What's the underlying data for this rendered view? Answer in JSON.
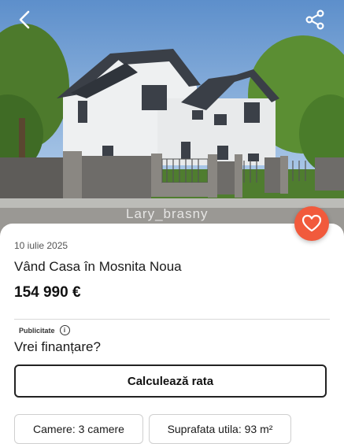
{
  "hero": {
    "watermark": "Lary_brasny",
    "back_icon": "chevron-left-icon",
    "share_icon": "share-icon",
    "favorite_icon": "heart-icon"
  },
  "listing": {
    "date": "10 iulie 2025",
    "title": "Vând Casa în Mosnita Noua",
    "price": "154 990 €"
  },
  "ad": {
    "label": "Publicitate",
    "info_icon": "info-icon",
    "question": "Vrei finanțare?",
    "button_label": "Calculează rata"
  },
  "features": [
    {
      "label": "Camere: 3 camere"
    },
    {
      "label": "Suprafata utila: 93 m²"
    }
  ],
  "colors": {
    "accent": "#f15a3c",
    "sky_top": "#5d8fcb",
    "sky_bottom": "#b9d3ef",
    "house_wall": "#eef0f1",
    "roof": "#3a3f47",
    "fence": "#6e6c69"
  }
}
